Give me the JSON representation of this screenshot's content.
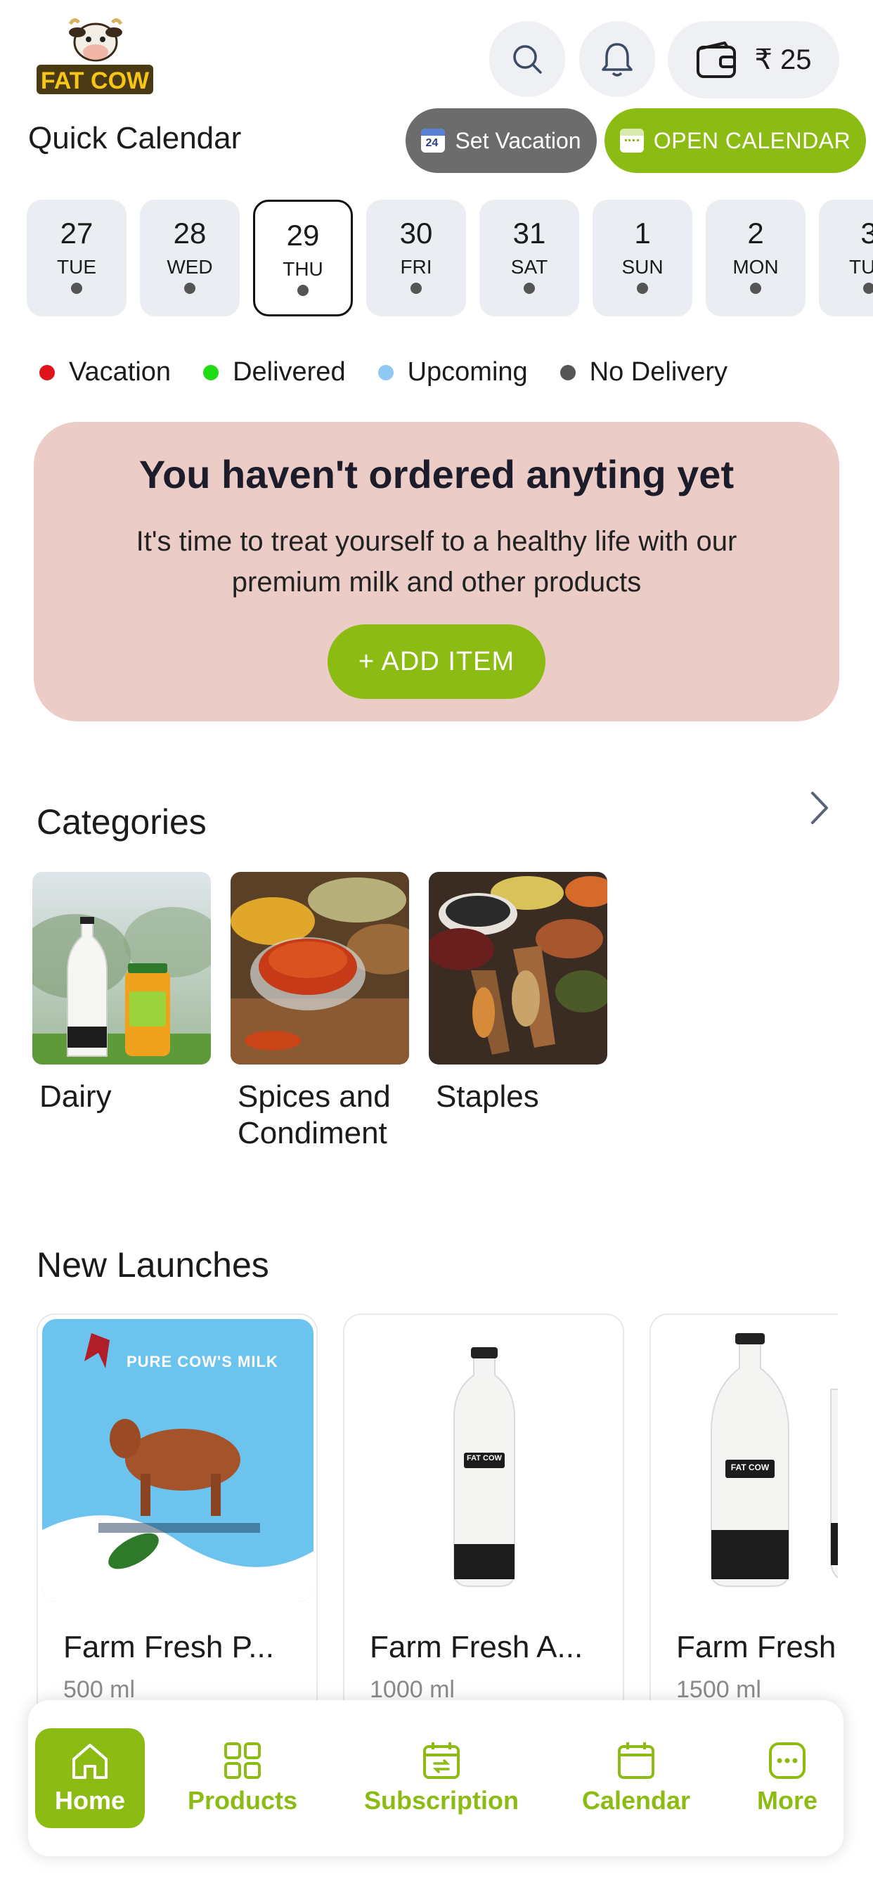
{
  "header": {
    "logo_text": "FAT COW",
    "wallet_amount": "₹ 25"
  },
  "quick_calendar": {
    "title": "Quick Calendar",
    "set_vacation_label": "Set Vacation",
    "open_calendar_label": "OPEN CALENDAR",
    "dates": [
      {
        "num": "27",
        "day": "TUE",
        "selected": false
      },
      {
        "num": "28",
        "day": "WED",
        "selected": false
      },
      {
        "num": "29",
        "day": "THU",
        "selected": true
      },
      {
        "num": "30",
        "day": "FRI",
        "selected": false
      },
      {
        "num": "31",
        "day": "SAT",
        "selected": false
      },
      {
        "num": "1",
        "day": "SUN",
        "selected": false
      },
      {
        "num": "2",
        "day": "MON",
        "selected": false
      },
      {
        "num": "3",
        "day": "TUE",
        "selected": false
      }
    ]
  },
  "legend": [
    {
      "label": "Vacation",
      "color": "#e0131a"
    },
    {
      "label": "Delivered",
      "color": "#1fdc14"
    },
    {
      "label": "Upcoming",
      "color": "#8ec9f3"
    },
    {
      "label": "No Delivery",
      "color": "#555555"
    }
  ],
  "empty_state": {
    "title": "You haven't ordered anyting yet",
    "text": "It's time to treat yourself to a healthy life with our premium milk and other products",
    "add_button": "+ ADD  ITEM"
  },
  "categories": {
    "title": "Categories",
    "items": [
      {
        "label": "Dairy"
      },
      {
        "label": "Spices and Condiment"
      },
      {
        "label": "Staples"
      }
    ]
  },
  "new_launches": {
    "title": "New Launches",
    "products": [
      {
        "name": "Farm Fresh P...",
        "size": "500 ml",
        "image_text": "PURE COW'S MILK"
      },
      {
        "name": "Farm Fresh A...",
        "size": "1000 ml",
        "image_text": "FAT COW"
      },
      {
        "name": "Farm Fresh",
        "size": "1500 ml",
        "image_text": "FAT COW"
      }
    ]
  },
  "bottom_nav": {
    "items": [
      {
        "label": "Home",
        "icon": "home-icon",
        "active": true
      },
      {
        "label": "Products",
        "icon": "grid-icon",
        "active": false
      },
      {
        "label": "Subscription",
        "icon": "subscription-calendar-icon",
        "active": false
      },
      {
        "label": "Calendar",
        "icon": "calendar-icon",
        "active": false
      },
      {
        "label": "More",
        "icon": "more-dots-icon",
        "active": false
      }
    ]
  },
  "colors": {
    "accent": "#8cbc13",
    "vacation_button": "#6c6c6c",
    "empty_card_bg": "#ecccc7"
  }
}
